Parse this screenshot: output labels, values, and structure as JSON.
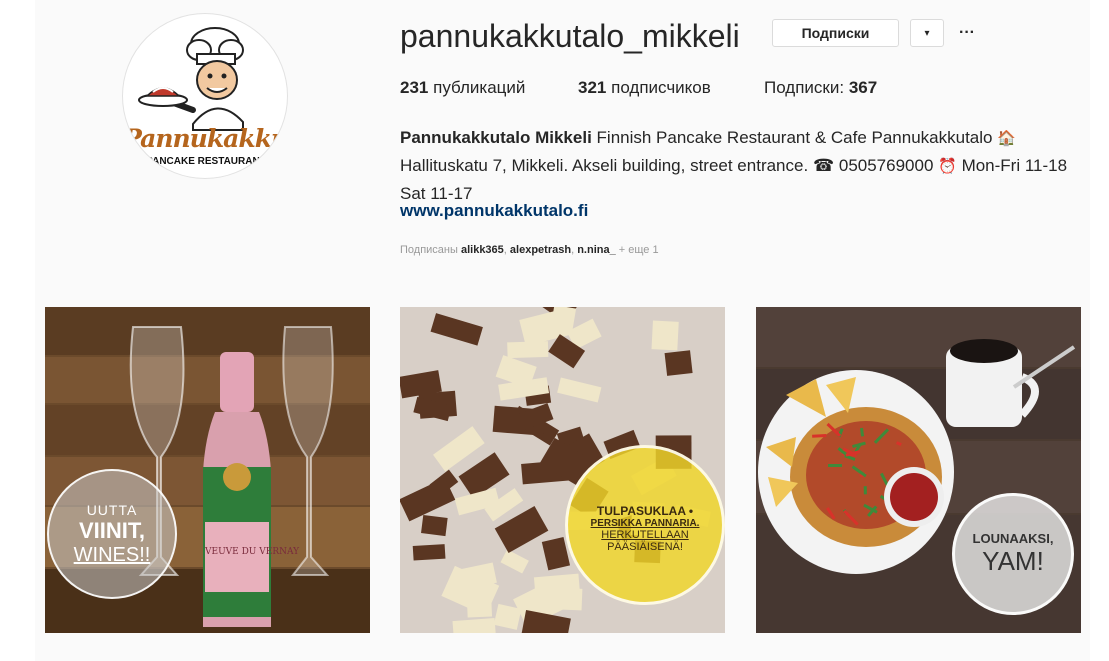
{
  "profile": {
    "avatar_logo_text": "Pannukakkutalo",
    "avatar_logo_subtext": "PANCAKE RESTAURANT",
    "username": "pannukakkutalo_mikkeli",
    "follow_button": "Подписки",
    "dropdown_icon": "▾",
    "more_icon": "···"
  },
  "stats": {
    "posts_count": "231",
    "posts_label": "публикаций",
    "followers_count": "321",
    "followers_label": "подписчиков",
    "following_label": "Подписки:",
    "following_count": "367"
  },
  "bio": {
    "name": "Pannukakkutalo Mikkeli",
    "text_1": "Finnish Pancake Restaurant & Cafe Pannukakkutalo",
    "house_icon": "🏠",
    "text_2": "Hallituskatu 7, Mikkeli. Akseli building, street entrance.",
    "phone_icon": "☎",
    "phone": "0505769000",
    "clock_icon": "⏰",
    "hours": "Mon-Fri 11-18 Sat 11-17",
    "website": "www.pannukakkutalo.fi"
  },
  "followed_by": {
    "prefix": "Подписаны",
    "users": [
      "alikk365",
      "alexpetrash",
      "n.nina_"
    ],
    "suffix": "+ еще 1"
  },
  "posts": [
    {
      "badge_line_1": "UUTTA",
      "badge_line_2": "VIINIT,",
      "badge_line_3": "WINES!!",
      "bottle_label": "VEUVE DU VERNAY"
    },
    {
      "badge_line_1": "TULPASUKLAA •",
      "badge_line_2": "PERSIKKA PANNARIA.",
      "badge_line_3": "HERKUTELLAAN",
      "badge_line_4": "PÄÄSIÄISENÄ!"
    },
    {
      "badge_line_1": "LOUNAAKSI,",
      "badge_line_2": "YAM!"
    }
  ]
}
